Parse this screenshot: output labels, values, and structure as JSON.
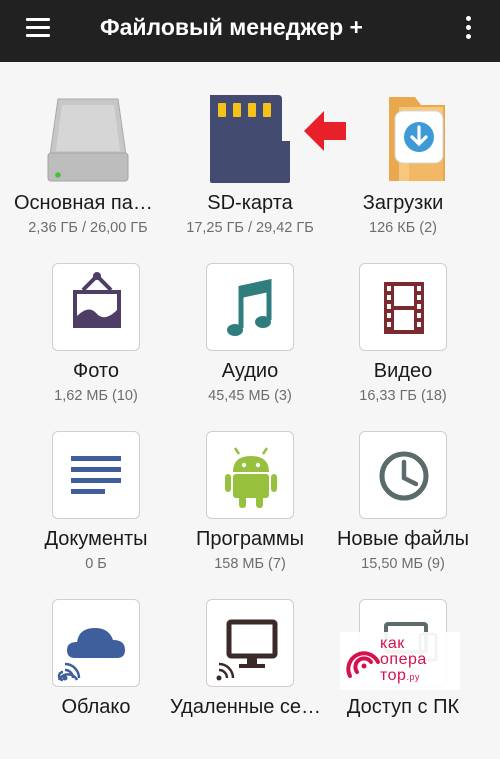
{
  "appbar": {
    "title": "Файловый менеджер +"
  },
  "tiles": [
    {
      "label": "Основная память",
      "sub": "2,36 ГБ / 26,00 ГБ"
    },
    {
      "label": "SD-карта",
      "sub": "17,25 ГБ / 29,42 ГБ"
    },
    {
      "label": "Загрузки",
      "sub": "126 КБ (2)"
    },
    {
      "label": "Фото",
      "sub": "1,62 МБ (10)"
    },
    {
      "label": "Аудио",
      "sub": "45,45 МБ (3)"
    },
    {
      "label": "Видео",
      "sub": "16,33 ГБ (18)"
    },
    {
      "label": "Документы",
      "sub": "0 Б"
    },
    {
      "label": "Программы",
      "sub": "158 МБ (7)"
    },
    {
      "label": "Новые файлы",
      "sub": "15,50 МБ (9)"
    },
    {
      "label": "Облако",
      "sub": ""
    },
    {
      "label": "Удаленные сервисы",
      "sub": ""
    },
    {
      "label": "Доступ с ПК",
      "sub": ""
    }
  ],
  "watermark": {
    "line1": "как",
    "line2": "опера",
    "line3": "тор",
    "suffix": ".ру"
  },
  "colors": {
    "appbar": "#212121",
    "icon_navy": "#3e4a6b",
    "icon_teal": "#2f7d7d",
    "icon_maroon": "#7b2b2f",
    "icon_blue": "#3f5e9c",
    "icon_green": "#97c03d",
    "icon_gray": "#5b6b6b",
    "arrow_red": "#e8202a",
    "folder": "#f2b866"
  },
  "icons": [
    "menu-icon",
    "more-vert-icon",
    "hard-drive-icon",
    "sd-card-icon",
    "download-folder-icon",
    "photo-frame-icon",
    "music-note-icon",
    "film-strip-icon",
    "document-lines-icon",
    "android-icon",
    "clock-icon",
    "cloud-icon",
    "monitor-icon",
    "pc-access-icon"
  ]
}
